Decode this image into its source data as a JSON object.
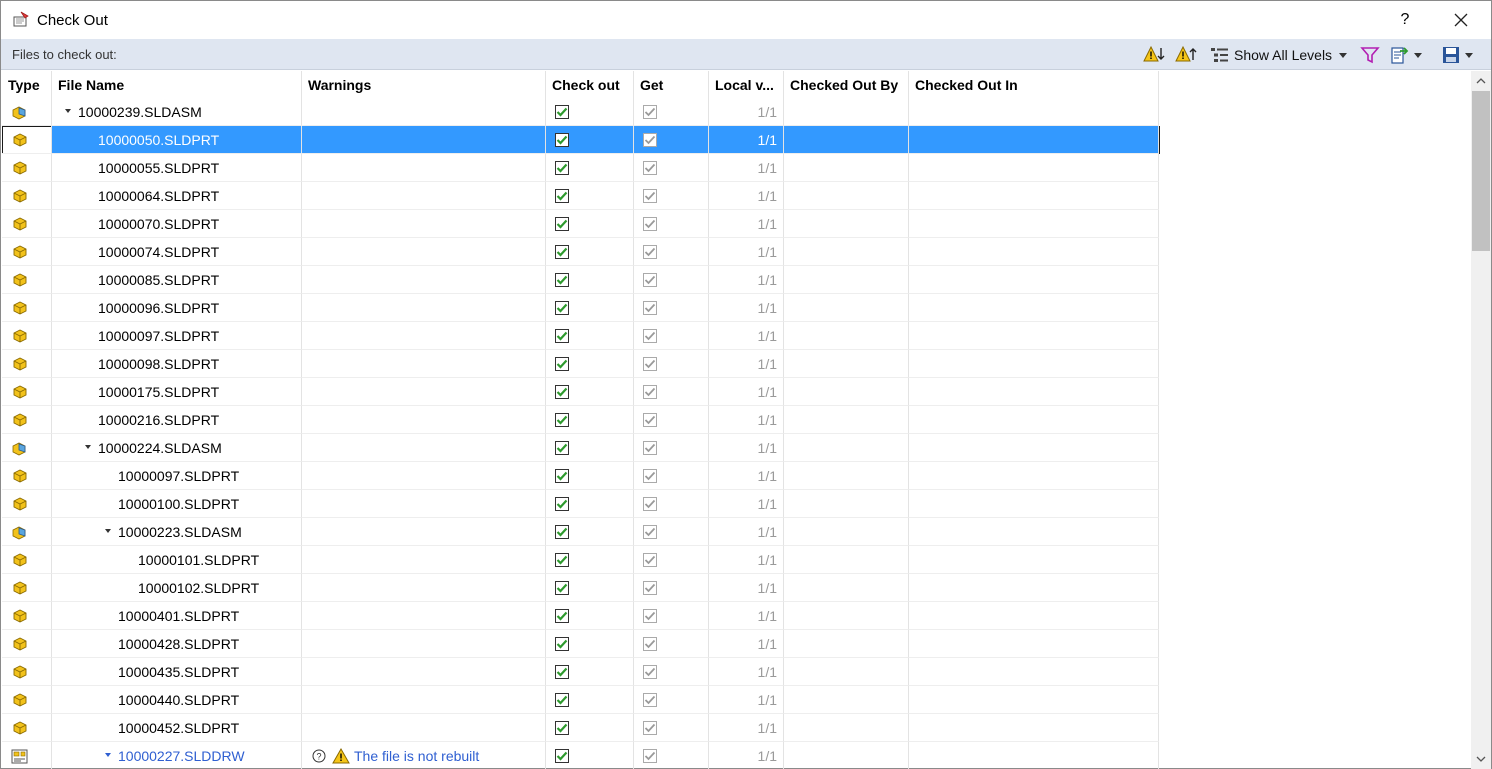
{
  "window": {
    "title": "Check Out",
    "help_label": "?"
  },
  "toolbar": {
    "caption": "Files to check out:",
    "show_levels_label": "Show All Levels"
  },
  "columns": {
    "type": "Type",
    "name": "File Name",
    "warnings": "Warnings",
    "checkout": "Check out",
    "get": "Get",
    "local": "Local v...",
    "checked_out_by": "Checked Out By",
    "checked_out_in": "Checked Out In"
  },
  "rows": [
    {
      "name": "10000239.SLDASM",
      "kind": "asm",
      "level": 0,
      "expanded": true,
      "local": "1/1",
      "warning": ""
    },
    {
      "name": "10000050.SLDPRT",
      "kind": "prt",
      "level": 1,
      "local": "1/1",
      "warning": "",
      "selected": true
    },
    {
      "name": "10000055.SLDPRT",
      "kind": "prt",
      "level": 1,
      "local": "1/1",
      "warning": ""
    },
    {
      "name": "10000064.SLDPRT",
      "kind": "prt",
      "level": 1,
      "local": "1/1",
      "warning": ""
    },
    {
      "name": "10000070.SLDPRT",
      "kind": "prt",
      "level": 1,
      "local": "1/1",
      "warning": ""
    },
    {
      "name": "10000074.SLDPRT",
      "kind": "prt",
      "level": 1,
      "local": "1/1",
      "warning": ""
    },
    {
      "name": "10000085.SLDPRT",
      "kind": "prt",
      "level": 1,
      "local": "1/1",
      "warning": ""
    },
    {
      "name": "10000096.SLDPRT",
      "kind": "prt",
      "level": 1,
      "local": "1/1",
      "warning": ""
    },
    {
      "name": "10000097.SLDPRT",
      "kind": "prt",
      "level": 1,
      "local": "1/1",
      "warning": ""
    },
    {
      "name": "10000098.SLDPRT",
      "kind": "prt",
      "level": 1,
      "local": "1/1",
      "warning": ""
    },
    {
      "name": "10000175.SLDPRT",
      "kind": "prt",
      "level": 1,
      "local": "1/1",
      "warning": ""
    },
    {
      "name": "10000216.SLDPRT",
      "kind": "prt",
      "level": 1,
      "local": "1/1",
      "warning": ""
    },
    {
      "name": "10000224.SLDASM",
      "kind": "asm",
      "level": 1,
      "expanded": true,
      "local": "1/1",
      "warning": ""
    },
    {
      "name": "10000097.SLDPRT",
      "kind": "prt",
      "level": 2,
      "local": "1/1",
      "warning": ""
    },
    {
      "name": "10000100.SLDPRT",
      "kind": "prt",
      "level": 2,
      "local": "1/1",
      "warning": ""
    },
    {
      "name": "10000223.SLDASM",
      "kind": "asm",
      "level": 2,
      "expanded": true,
      "local": "1/1",
      "warning": ""
    },
    {
      "name": "10000101.SLDPRT",
      "kind": "prt",
      "level": 3,
      "local": "1/1",
      "warning": ""
    },
    {
      "name": "10000102.SLDPRT",
      "kind": "prt",
      "level": 3,
      "local": "1/1",
      "warning": ""
    },
    {
      "name": "10000401.SLDPRT",
      "kind": "prt",
      "level": 2,
      "local": "1/1",
      "warning": ""
    },
    {
      "name": "10000428.SLDPRT",
      "kind": "prt",
      "level": 2,
      "local": "1/1",
      "warning": ""
    },
    {
      "name": "10000435.SLDPRT",
      "kind": "prt",
      "level": 2,
      "local": "1/1",
      "warning": ""
    },
    {
      "name": "10000440.SLDPRT",
      "kind": "prt",
      "level": 2,
      "local": "1/1",
      "warning": ""
    },
    {
      "name": "10000452.SLDPRT",
      "kind": "prt",
      "level": 2,
      "local": "1/1",
      "warning": ""
    },
    {
      "name": "10000227.SLDDRW",
      "kind": "drw",
      "level": 2,
      "expanded": true,
      "local": "1/1",
      "warning": "The file is not rebuilt",
      "link": true
    }
  ],
  "colors": {
    "selection": "#3399ff",
    "toolbar_bg": "#dfe6f1",
    "check_green": "#2e9a2e",
    "link_blue": "#2f5fd1",
    "part_yellow": "#f2c21b",
    "asm_blue": "#5aa5de"
  }
}
